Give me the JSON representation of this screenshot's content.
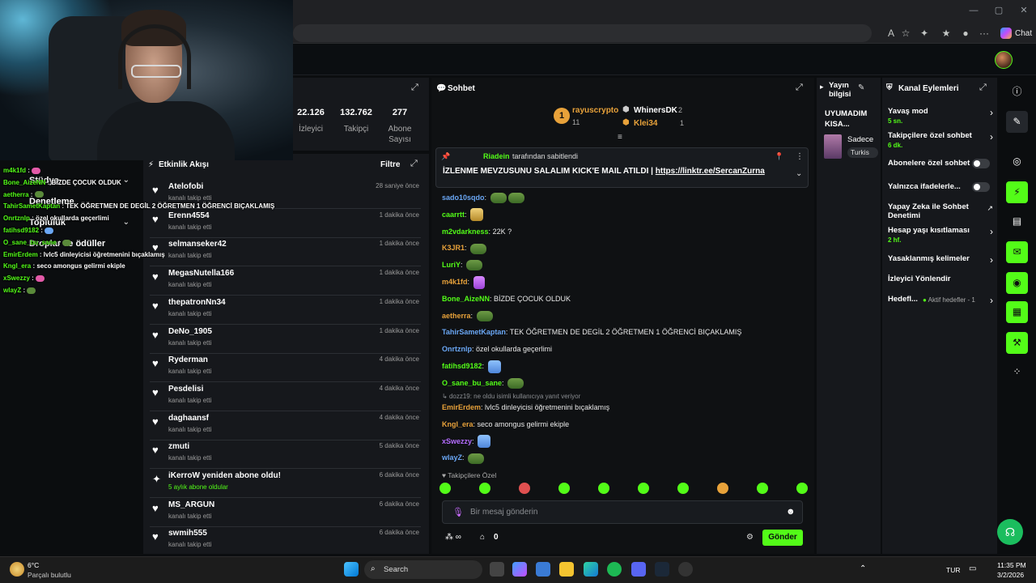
{
  "stats": {
    "viewers": {
      "value": "22.126",
      "label": "İzleyici"
    },
    "followers": {
      "value": "132.762",
      "label": "Takipçi"
    },
    "subs": {
      "value": "277",
      "label": "Abone Sayısı"
    }
  },
  "overlay_chat": [
    {
      "name": "m4k1fd",
      "text": "",
      "emote": "pink"
    },
    {
      "name": "Bone_AizeNN",
      "text": "BİZDE ÇOCUK OLDUK",
      "emote": ""
    },
    {
      "name": "aetherra",
      "text": "",
      "emote": "green"
    },
    {
      "name": "TahirSametKaptan",
      "text": "TEK ÖĞRETMEN DE DEGİL 2 ÖĞRETMEN 1 ÖĞRENCİ BIÇAKLAMIŞ",
      "emote": ""
    },
    {
      "name": "Onrtznlp",
      "text": "özel okullarda geçerlimi",
      "emote": ""
    },
    {
      "name": "fatihsd9182",
      "text": "",
      "emote": "blue"
    },
    {
      "name": "O_sane_bu_sane",
      "text": "",
      "emote": "green"
    },
    {
      "name": "EmirErdem",
      "text": "lvlc5 dinleyicisi öğretmenini bıçaklamış",
      "emote": ""
    },
    {
      "name": "Kngl_era",
      "text": "seco amongus gelirmi ekiple",
      "emote": ""
    },
    {
      "name": "xSwezzy",
      "text": "",
      "emote": "pink"
    },
    {
      "name": "wlayZ",
      "text": "",
      "emote": "green"
    }
  ],
  "studio_menu": [
    "Stüdyo",
    "Denetleme",
    "Topluluk",
    "Droplar ve ödüller"
  ],
  "feed": {
    "title": "Etkinlik Akışı",
    "filter": "Filtre",
    "events": [
      {
        "name": "Atelofobi",
        "sub": "kanalı takip etti",
        "time": "28 saniye önce",
        "type": "follow"
      },
      {
        "name": "Erenn4554",
        "sub": "kanalı takip etti",
        "time": "1 dakika önce",
        "type": "follow"
      },
      {
        "name": "selmanseker42",
        "sub": "kanalı takip etti",
        "time": "1 dakika önce",
        "type": "follow"
      },
      {
        "name": "MegasNutella166",
        "sub": "kanalı takip etti",
        "time": "1 dakika önce",
        "type": "follow"
      },
      {
        "name": "thepatronNn34",
        "sub": "kanalı takip etti",
        "time": "1 dakika önce",
        "type": "follow"
      },
      {
        "name": "DeNo_1905",
        "sub": "kanalı takip etti",
        "time": "1 dakika önce",
        "type": "follow"
      },
      {
        "name": "Ryderman",
        "sub": "kanalı takip etti",
        "time": "4 dakika önce",
        "type": "follow"
      },
      {
        "name": "Pesdelisi",
        "sub": "kanalı takip etti",
        "time": "4 dakika önce",
        "type": "follow"
      },
      {
        "name": "daghaansf",
        "sub": "kanalı takip etti",
        "time": "4 dakika önce",
        "type": "follow"
      },
      {
        "name": "zmuti",
        "sub": "kanalı takip etti",
        "time": "5 dakika önce",
        "type": "follow"
      },
      {
        "name": "iKerroW yeniden abone oldu!",
        "sub": "5 aylık abone oldular",
        "time": "6 dakika önce",
        "type": "sub"
      },
      {
        "name": "MS_ARGUN",
        "sub": "kanalı takip etti",
        "time": "6 dakika önce",
        "type": "follow"
      },
      {
        "name": "swmih555",
        "sub": "kanalı takip etti",
        "time": "6 dakika önce",
        "type": "follow"
      }
    ]
  },
  "chat": {
    "title": "Sohbet",
    "leaders": {
      "first": {
        "rank": "1",
        "name": "rayuscrypto",
        "count": "11"
      },
      "second": {
        "name": "WhinersDK",
        "count": "2"
      },
      "third": {
        "name": "Klei34",
        "count": "1"
      }
    },
    "pinned": {
      "by": "Riadein",
      "by_suffix": "tarafından sabitlendi",
      "text": "İZLENME MEVZUSUNU SALALIM KICK'E MAIL ATILDI |",
      "link": "https://linktr.ee/SercanZurna"
    },
    "messages": [
      {
        "user": "sado10sqdo",
        "color": "#6aa7f5",
        "text": "",
        "emote": "green2"
      },
      {
        "user": "caarrtt",
        "color": "#53fc18",
        "text": "",
        "emote": "gold"
      },
      {
        "user": "m2vdarkness",
        "color": "#53fc18",
        "text": "22K ?",
        "emote": ""
      },
      {
        "user": "K3JR1",
        "color": "#e8a23a",
        "text": "",
        "emote": "green"
      },
      {
        "user": "LuriY",
        "color": "#53fc18",
        "text": "",
        "emote": "green"
      },
      {
        "user": "m4k1fd",
        "color": "#e8a23a",
        "text": "",
        "emote": "pink"
      },
      {
        "user": "Bone_AizeNN",
        "color": "#53fc18",
        "text": "BİZDE ÇOCUK OLDUK",
        "emote": ""
      },
      {
        "user": "aetherra",
        "color": "#e8a23a",
        "text": "",
        "emote": "green"
      },
      {
        "user": "TahirSametKaptan",
        "color": "#6aa7f5",
        "text": "TEK ÖĞRETMEN DE DEGİL 2 ÖĞRETMEN 1 ÖĞRENCİ BIÇAKLAMIŞ",
        "emote": ""
      },
      {
        "user": "Onrtznlp",
        "color": "#6aa7f5",
        "text": "özel okullarda geçerlimi",
        "emote": ""
      },
      {
        "user": "fatihsd9182",
        "color": "#53fc18",
        "text": "",
        "emote": "blue"
      },
      {
        "user": "O_sane_bu_sane",
        "color": "#53fc18",
        "text": "",
        "emote": "green"
      }
    ],
    "reply_note": "dozz19: ne oldu isimli kullanıcıya yanıt veriyor",
    "messages2": [
      {
        "user": "EmirErdem",
        "color": "#e8a23a",
        "text": "lvlc5 dinleyicisi öğretmenini bıçaklamış",
        "emote": ""
      },
      {
        "user": "Kngl_era",
        "color": "#e8a23a",
        "text": "seco amongus gelirmi ekiple",
        "emote": ""
      },
      {
        "user": "xSwezzy",
        "color": "#b46cff",
        "text": "",
        "emote": "blue"
      },
      {
        "user": "wlayZ",
        "color": "#6aa7f5",
        "text": "",
        "emote": "green"
      }
    ],
    "followers_only": "Takipçilere Özel",
    "placeholder": "Bir mesaj gönderin",
    "points": "0",
    "send": "Gönder"
  },
  "stream_info": {
    "title": "Yayın bilgisi",
    "stream_title": "UYUMADIM KISA...",
    "category": "Sadece",
    "lang_tag": "Turkis"
  },
  "actions": {
    "title": "Kanal Eylemleri",
    "items": [
      {
        "label": "Yavaş mod",
        "sub": "5 sn.",
        "kind": "chevron"
      },
      {
        "label": "Takipçilere özel sohbet",
        "sub": "6 dk.",
        "kind": "chevron"
      },
      {
        "label": "Abonelere özel sohbet",
        "sub": "",
        "kind": "toggle"
      },
      {
        "label": "Yalnızca ifadelerle...",
        "sub": "",
        "kind": "toggle"
      },
      {
        "label": "Yapay Zeka ile Sohbet Denetimi",
        "sub": "",
        "kind": "external"
      },
      {
        "label": "Hesap yaşı kısıtlaması",
        "sub": "2 hf.",
        "kind": "chevron"
      },
      {
        "label": "Yasaklanmış kelimeler",
        "sub": "",
        "kind": "chevron"
      },
      {
        "label": "İzleyici Yönlendir",
        "sub": "",
        "kind": "none"
      },
      {
        "label": "Hedefl...",
        "sub": "",
        "kind": "goal",
        "goal": "Aktif hedefler - 1"
      }
    ]
  },
  "browser": {
    "chat_label": "Chat"
  },
  "taskbar": {
    "weather_temp": "6°C",
    "weather_desc": "Parçalı bulutlu",
    "search": "Search",
    "lang": "TUR",
    "time": "11:35 PM",
    "date": "3/2/2026"
  },
  "colors": {
    "accent": "#53fc18",
    "panel": "#16181c",
    "bg": "#0b0d0f"
  }
}
